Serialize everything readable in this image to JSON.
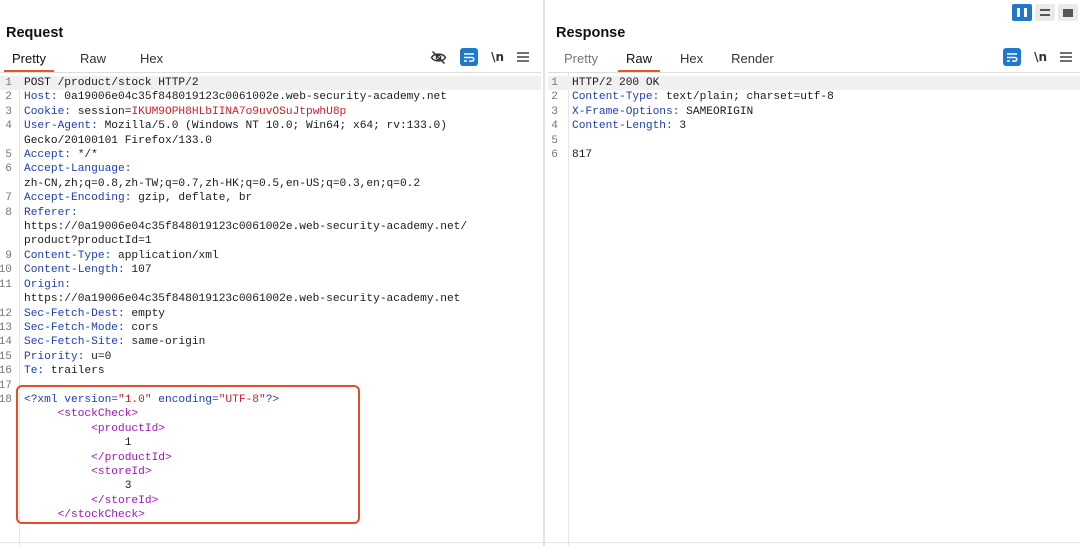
{
  "layout_buttons": [
    {
      "icon": "split-columns-icon",
      "active": true
    },
    {
      "icon": "split-rows-icon",
      "active": false
    },
    {
      "icon": "single-panel-icon",
      "active": false
    }
  ],
  "request": {
    "title": "Request",
    "tabs": [
      "Pretty",
      "Raw",
      "Hex"
    ],
    "active_tab": "Pretty",
    "tools": {
      "hide_icon": "eye-slash-icon",
      "wrap_icon": "word-wrap-icon",
      "newline_label": "\\n",
      "menu_icon": "hamburger-menu-icon"
    },
    "lines": [
      {
        "n": "1",
        "key": "",
        "val": "POST /product/stock HTTP/2"
      },
      {
        "n": "2",
        "key": "Host:",
        "val": " 0a19006e04c35f848019123c0061002e.web-security-academy.net"
      },
      {
        "n": "3",
        "key": "Cookie:",
        "val": " session=",
        "cookie": "IKUM9OPH8HLbIINA7o9uvOSuJtpwhU8p"
      },
      {
        "n": "4",
        "key": "User-Agent:",
        "val": " Mozilla/5.0 (Windows NT 10.0; Win64; x64; rv:133.0)"
      },
      {
        "n": "",
        "key": "",
        "val": "Gecko/20100101 Firefox/133.0"
      },
      {
        "n": "5",
        "key": "Accept:",
        "val": " */*"
      },
      {
        "n": "6",
        "key": "Accept-Language:",
        "val": ""
      },
      {
        "n": "",
        "key": "",
        "val": "zh-CN,zh;q=0.8,zh-TW;q=0.7,zh-HK;q=0.5,en-US;q=0.3,en;q=0.2"
      },
      {
        "n": "7",
        "key": "Accept-Encoding:",
        "val": " gzip, deflate, br"
      },
      {
        "n": "8",
        "key": "Referer:",
        "val": ""
      },
      {
        "n": "",
        "key": "",
        "val": "https://0a19006e04c35f848019123c0061002e.web-security-academy.net/"
      },
      {
        "n": "",
        "key": "",
        "val": "product?productId=1"
      },
      {
        "n": "9",
        "key": "Content-Type:",
        "val": " application/xml"
      },
      {
        "n": "10",
        "key": "Content-Length:",
        "val": " 107"
      },
      {
        "n": "11",
        "key": "Origin:",
        "val": ""
      },
      {
        "n": "",
        "key": "",
        "val": "https://0a19006e04c35f848019123c0061002e.web-security-academy.net"
      },
      {
        "n": "12",
        "key": "Sec-Fetch-Dest:",
        "val": " empty"
      },
      {
        "n": "13",
        "key": "Sec-Fetch-Mode:",
        "val": " cors"
      },
      {
        "n": "14",
        "key": "Sec-Fetch-Site:",
        "val": " same-origin"
      },
      {
        "n": "15",
        "key": "Priority:",
        "val": " u=0"
      },
      {
        "n": "16",
        "key": "Te:",
        "val": " trailers"
      },
      {
        "n": "17",
        "key": "",
        "val": ""
      }
    ],
    "xml_lines": [
      {
        "n": "18",
        "indent": "",
        "parts": [
          [
            "xp",
            "<?xml version="
          ],
          [
            "xs",
            "\"1.0\""
          ],
          [
            "xp",
            " encoding="
          ],
          [
            "xs",
            "\"UTF-8\""
          ],
          [
            "xp",
            "?>"
          ]
        ]
      },
      {
        "n": "",
        "indent": "     ",
        "parts": [
          [
            "xt",
            "<stockCheck>"
          ]
        ]
      },
      {
        "n": "",
        "indent": "          ",
        "parts": [
          [
            "xt",
            "<productId>"
          ]
        ]
      },
      {
        "n": "",
        "indent": "               ",
        "parts": [
          [
            "tx",
            "1"
          ]
        ]
      },
      {
        "n": "",
        "indent": "          ",
        "parts": [
          [
            "xt",
            "</productId>"
          ]
        ]
      },
      {
        "n": "",
        "indent": "          ",
        "parts": [
          [
            "xt",
            "<storeId>"
          ]
        ]
      },
      {
        "n": "",
        "indent": "               ",
        "parts": [
          [
            "tx",
            "3"
          ]
        ]
      },
      {
        "n": "",
        "indent": "          ",
        "parts": [
          [
            "xt",
            "</storeId>"
          ]
        ]
      },
      {
        "n": "",
        "indent": "     ",
        "parts": [
          [
            "xt",
            "</stockCheck>"
          ]
        ]
      }
    ]
  },
  "response": {
    "title": "Response",
    "tabs": [
      "Pretty",
      "Raw",
      "Hex",
      "Render"
    ],
    "active_tab": "Raw",
    "tools": {
      "wrap_icon": "word-wrap-icon",
      "newline_label": "\\n",
      "menu_icon": "hamburger-menu-icon"
    },
    "lines": [
      {
        "n": "1",
        "key": "",
        "val": "HTTP/2 200 OK"
      },
      {
        "n": "2",
        "key": "Content-Type:",
        "val": " text/plain; charset=utf-8"
      },
      {
        "n": "3",
        "key": "X-Frame-Options:",
        "val": " SAMEORIGIN"
      },
      {
        "n": "4",
        "key": "Content-Length:",
        "val": " 3"
      },
      {
        "n": "5",
        "key": "",
        "val": ""
      },
      {
        "n": "6",
        "key": "",
        "val": "817"
      }
    ]
  }
}
